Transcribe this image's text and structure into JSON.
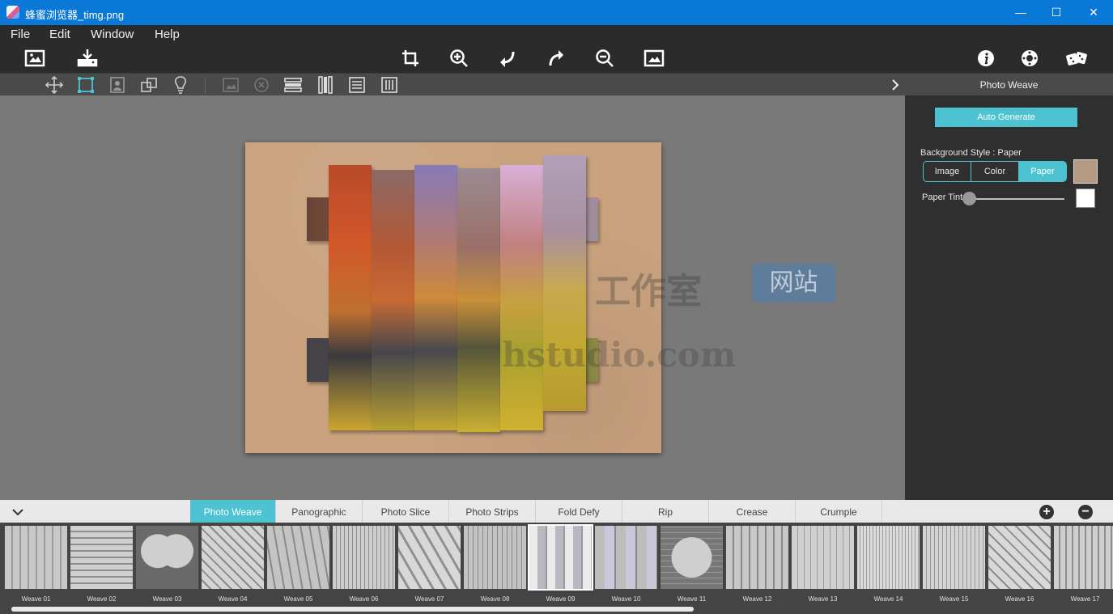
{
  "window": {
    "title": "蜂蜜浏览器_timg.png",
    "minimize": "—",
    "maximize": "☐",
    "close": "✕"
  },
  "menu": [
    "File",
    "Edit",
    "Window",
    "Help"
  ],
  "panel": {
    "header": "Photo Weave",
    "auto_generate": "Auto Generate",
    "background_style_label": "Background Style : Paper",
    "styles": [
      "Image",
      "Color",
      "Paper"
    ],
    "selected_style": "Paper",
    "paper_tint_label": "Paper Tint",
    "paper_swatch_color": "#b49a82",
    "tint_color": "#ffffff",
    "tint_level": 0
  },
  "watermark": {
    "cn": "工作室",
    "badge": "网站",
    "url": "hstudio.com"
  },
  "tabs": [
    "Photo Weave",
    "Panographic",
    "Photo Slice",
    "Photo Strips",
    "Fold Defy",
    "Rip",
    "Crease",
    "Crumple"
  ],
  "active_tab": "Photo Weave",
  "thumbnails": [
    "Weave 01",
    "Weave 02",
    "Weave 03",
    "Weave 04",
    "Weave 05",
    "Weave 06",
    "Weave 07",
    "Weave 08",
    "Weave 09",
    "Weave 10",
    "Weave 11",
    "Weave 12",
    "Weave 13",
    "Weave 14",
    "Weave 15",
    "Weave 16",
    "Weave 17"
  ],
  "selected_thumbnail": "Weave 09",
  "colors": {
    "accent": "#4dc3d1",
    "titlebar": "#0a78d7",
    "paper": "#c9a27e"
  }
}
